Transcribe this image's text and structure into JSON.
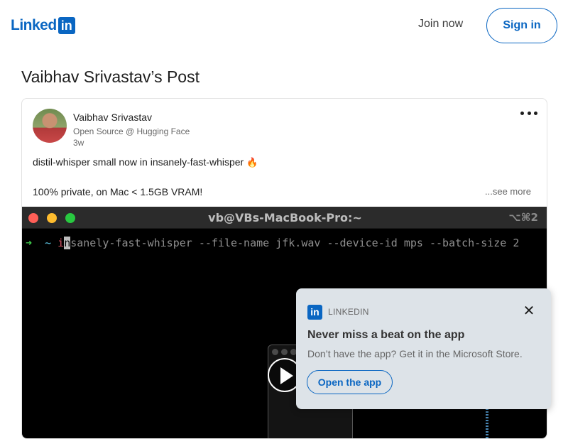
{
  "header": {
    "logo_text": "Linked",
    "logo_badge": "in",
    "join_label": "Join now",
    "signin_label": "Sign in"
  },
  "page": {
    "title": "Vaibhav Srivastav’s Post"
  },
  "post": {
    "author_name": "Vaibhav Srivastav",
    "author_headline": "Open Source @ Hugging Face",
    "time": "3w",
    "text_line1": "distil-whisper small now in insanely-fast-whisper",
    "fire_emoji": "🔥",
    "text_line2": "100% private, on Mac < 1.5GB VRAM!",
    "see_more": "...see more"
  },
  "terminal": {
    "title": "vb@VBs-MacBook-Pro:~",
    "shortcut": "⌥⌘2",
    "prompt_arrow": "➜",
    "prompt_dir": "~",
    "cmd_first": "i",
    "cmd_cursor": "n",
    "cmd_rest": "sanely-fast-whisper --file-name jfk.wav --device-id mps --batch-size 2"
  },
  "popup": {
    "brand": "LINKEDIN",
    "badge": "in",
    "close": "✕",
    "title": "Never miss a beat on the app",
    "description": "Don’t have the app? Get it in the Microsoft Store.",
    "button_label": "Open the app"
  },
  "colors": {
    "brand_blue": "#0a66c2",
    "popup_bg": "#dde3e8",
    "terminal_bg": "#000000"
  }
}
